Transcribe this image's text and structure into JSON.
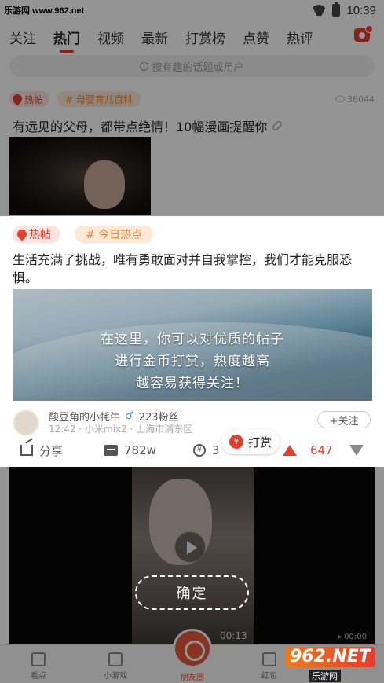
{
  "status_bar": {
    "watermark": "乐游网 www.962.net",
    "time": "10:39"
  },
  "tabs": [
    "关注",
    "热门",
    "视频",
    "最新",
    "打赏榜",
    "点赞",
    "热评"
  ],
  "search": {
    "placeholder": "搜有趣的话题或用户"
  },
  "post1": {
    "hot_label": "热帖",
    "topic": "# 母婴育儿百科",
    "views": "36044",
    "title": "有远见的父母，都带点绝情！10幅漫画提醒你"
  },
  "post2": {
    "hot_label": "热帖",
    "topic": "# 今日热点",
    "title": "生活充满了挑战，唯有勇敢面对并自我掌控，我们才能克服恐惧。",
    "image_caption": [
      "在这里，你可以对优质的帖子",
      "进行金币打赏，热度越高",
      "越容易获得关注！"
    ],
    "author_name": "酸豆角的小牦牛",
    "gender_symbol": "♂",
    "followers": "223粉丝",
    "meta": "12:42 · 小米mix2 · 上海市浦东区",
    "follow_label": "+关注",
    "share_label": "分享",
    "comment_count": "782w",
    "coin_prefix": "3",
    "vote_count": "647",
    "reward_tip": "打赏"
  },
  "video": {
    "time": "00:13",
    "duration": "▸ 00:00"
  },
  "confirm_label": "确定",
  "bottom_nav": [
    "看点",
    "小游戏",
    "朋友圈",
    "红包"
  ],
  "watermark_br": {
    "top": "962.NET",
    "bottom": "乐游网"
  },
  "colors": {
    "accent": "#e5402d",
    "topic": "#f08a3b"
  }
}
